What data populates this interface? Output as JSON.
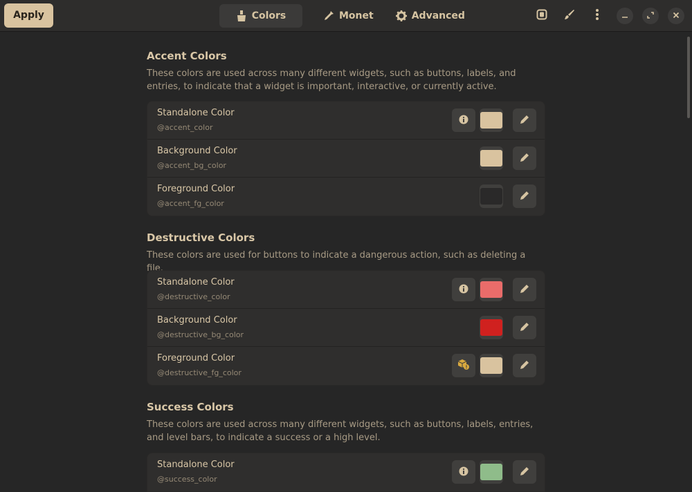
{
  "header": {
    "apply_label": "Apply",
    "tabs": [
      {
        "label": "Colors",
        "icon": "brush-icon",
        "active": true
      },
      {
        "label": "Monet",
        "icon": "eyedropper-icon",
        "active": false
      },
      {
        "label": "Advanced",
        "icon": "gear-icon",
        "active": false
      }
    ]
  },
  "sections": [
    {
      "title": "Accent Colors",
      "description": "These colors are used across many different widgets, such as buttons, labels, and entries, to indicate that a widget is important, interactive, or currently active.",
      "rows": [
        {
          "title": "Standalone Color",
          "var": "@accent_color",
          "color": "#d9c39f",
          "extra": "info"
        },
        {
          "title": "Background Color",
          "var": "@accent_bg_color",
          "color": "#d9c39f",
          "extra": ""
        },
        {
          "title": "Foreground Color",
          "var": "@accent_fg_color",
          "color": "#2a2929",
          "extra": ""
        }
      ]
    },
    {
      "title": "Destructive Colors",
      "description": "These colors are used for buttons to indicate a dangerous action, such as deleting a file.",
      "rows": [
        {
          "title": "Standalone Color",
          "var": "@destructive_color",
          "color": "#ea6c6a",
          "extra": "info"
        },
        {
          "title": "Background Color",
          "var": "@destructive_bg_color",
          "color": "#d0211f",
          "extra": ""
        },
        {
          "title": "Foreground Color",
          "var": "@destructive_fg_color",
          "color": "#d9c39f",
          "extra": "warning"
        }
      ]
    },
    {
      "title": "Success Colors",
      "description": "These colors are used across many different widgets, such as buttons, labels, entries, and level bars, to indicate a success or a high level.",
      "rows": [
        {
          "title": "Standalone Color",
          "var": "@success_color",
          "color": "#8fbc8a",
          "extra": "info"
        }
      ]
    }
  ]
}
